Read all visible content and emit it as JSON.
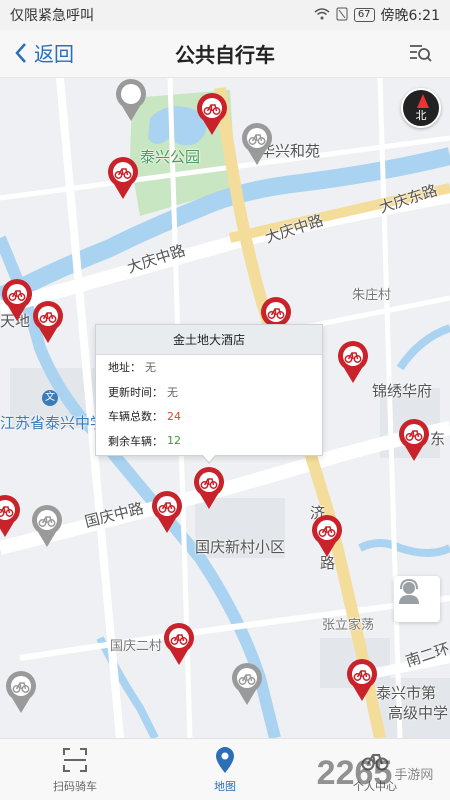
{
  "status_bar": {
    "carrier": "仅限紧急呼叫",
    "battery": "67",
    "time": "傍晚6:21"
  },
  "header": {
    "back_label": "返回",
    "title": "公共自行车"
  },
  "map": {
    "labels": {
      "park": "泰兴公园",
      "huaxing": "华兴和苑",
      "daqing_east": "大庆东路",
      "daqing_mid1": "大庆中路",
      "daqing_mid2": "大庆中路",
      "zhuzhuang": "朱庄村",
      "tiandi": "天地",
      "jinxiu": "锦绣华府",
      "school": "江苏省泰兴中学",
      "guoqing_road": "国庆中路",
      "guoqing_village": "国庆新村小区",
      "ji_road_1": "济",
      "ji_road_2": "路",
      "zhangli": "张立家荡",
      "guoqing_er": "国庆二村",
      "nanerhuan": "南二环",
      "taixing_no": "泰兴市第",
      "high_school": "高级中学",
      "dong": "东",
      "wen": "文"
    },
    "compass_label": "北"
  },
  "popup": {
    "title": "金土地大酒店",
    "address_label": "地址：",
    "address_value": "无",
    "update_label": "更新时间：",
    "update_value": "无",
    "total_label": "车辆总数：",
    "total_value": "24",
    "remain_label": "剩余车辆：",
    "remain_value": "12"
  },
  "bottom_nav": {
    "items": [
      {
        "label": "扫码骑车",
        "icon": "scan-icon"
      },
      {
        "label": "地图",
        "icon": "location-pin-icon"
      },
      {
        "label": "个人中心",
        "icon": "bicycle-icon"
      }
    ]
  },
  "watermark": {
    "text": "2265",
    "sub": "手游网"
  },
  "colors": {
    "accent": "#2d6fb6",
    "pin_red": "#c8222a",
    "pin_gray": "#9a9a9a",
    "total_red": "#d14a3a",
    "remain_green": "#3a9a3a"
  }
}
